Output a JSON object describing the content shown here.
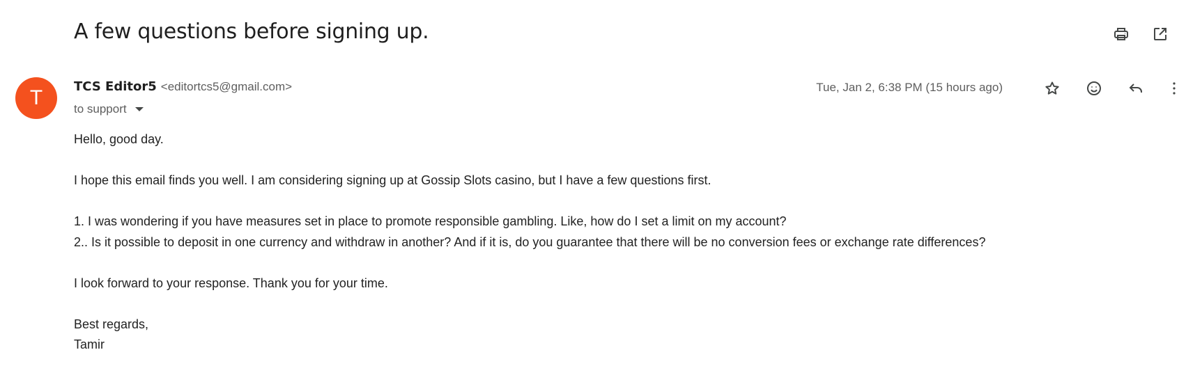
{
  "email": {
    "subject": "A few questions before signing up.",
    "sender": {
      "initial": "T",
      "name": "TCS Editor5",
      "email": "<editortcs5@gmail.com>",
      "avatar_color": "#f4511e"
    },
    "recipient": "to support",
    "date": "Tue, Jan 2, 6:38 PM (15 hours ago)",
    "body": {
      "greeting": "Hello, good day.",
      "intro": "I hope this email finds you well. I am considering signing up at Gossip Slots casino, but I have a few questions first.",
      "question_1": "1. I was wondering if you have measures set in place to promote responsible gambling. Like, how do I set a limit on my account?",
      "question_2": "2.. Is it possible to deposit in one currency and withdraw in another? And if it is, do you guarantee that there will be no conversion fees or exchange rate differences?",
      "closing_line": "I look forward to your response. Thank you for your time.",
      "signoff": "Best regards,",
      "signature": "Tamir"
    }
  },
  "icons": {
    "print": "print-icon",
    "open_new_window": "open-in-new-window-icon",
    "star": "star-icon",
    "emoji": "emoji-reaction-icon",
    "reply": "reply-icon",
    "more": "more-vertical-icon"
  }
}
